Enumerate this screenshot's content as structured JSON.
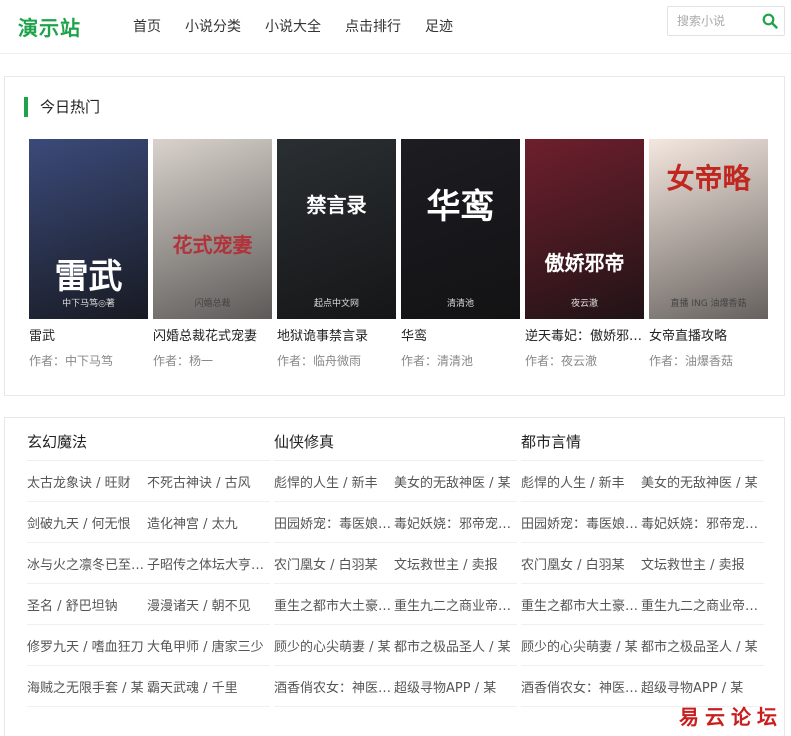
{
  "header": {
    "logo": "演示站",
    "nav": [
      "首页",
      "小说分类",
      "小说大全",
      "点击排行",
      "足迹"
    ],
    "search_placeholder": "搜索小说"
  },
  "hot": {
    "title": "今日热门",
    "books": [
      {
        "title": "雷武",
        "author": "作者：中下马笃",
        "cover_text": "雷武",
        "cover_sub": "中下马笃◎著",
        "bg": "#3b4a7a"
      },
      {
        "title": "闪婚总裁花式宠妻",
        "author": "作者：杨一",
        "cover_text": "花式宠妻",
        "cover_sub": "闪婚总裁",
        "bg": "#d9d2cc"
      },
      {
        "title": "地狱诡事禁言录",
        "author": "作者：临舟微雨",
        "cover_text": "禁言录",
        "cover_sub": "起点中文网",
        "bg": "#2a2f33"
      },
      {
        "title": "华鸾",
        "author": "作者：清清池",
        "cover_text": "华鸾",
        "cover_sub": "清清池",
        "bg": "#1c1c22"
      },
      {
        "title": "逆天毒妃：傲娇邪帝强势宠",
        "author": "作者：夜云澈",
        "cover_text": "傲娇邪帝",
        "cover_sub": "夜云澈",
        "bg": "#6e1f2d"
      },
      {
        "title": "女帝直播攻略",
        "author": "作者：油爆香菇",
        "cover_text": "女帝略",
        "cover_sub": "直播 ING 油爆香菇",
        "bg": "#f4e7df"
      }
    ]
  },
  "categories": [
    {
      "name": "玄幻魔法",
      "rows": [
        [
          "太古龙象诀 / 旺财",
          "不死古神诀 / 古风"
        ],
        [
          "剑破九天 / 何无恨",
          "造化神宫 / 太九"
        ],
        [
          "冰与火之凛冬已至 / 某",
          "子昭传之体坛大亨 / 某"
        ],
        [
          "圣名 / 舒巴坦钠",
          "漫漫诸天 / 朝不见"
        ],
        [
          "修罗九天 / 嗜血狂刀",
          "大龟甲师 / 唐家三少"
        ],
        [
          "海贼之无限手套 / 某",
          "霸天武魂 / 千里"
        ]
      ]
    },
    {
      "name": "仙侠修真",
      "rows": [
        [
          "彪悍的人生 / 新丰",
          "美女的无敌神医 / 某"
        ],
        [
          "田园娇宠：毒医娘子 / 某",
          "毒妃妖娆：邪帝宠 / 某"
        ],
        [
          "农门凰女 / 白羽某",
          "文坛救世主 / 卖报"
        ],
        [
          "重生之都市大土豪 / 某",
          "重生九二之商业帝国 / 某"
        ],
        [
          "顾少的心尖萌妻 / 某",
          "都市之极品圣人 / 某"
        ],
        [
          "酒香俏农女：神医 / 某",
          "超级寻物APP / 某"
        ]
      ]
    },
    {
      "name": "都市言情",
      "rows": [
        [
          "彪悍的人生 / 新丰",
          "美女的无敌神医 / 某"
        ],
        [
          "田园娇宠：毒医娘子 / 某",
          "毒妃妖娆：邪帝宠 / 某"
        ],
        [
          "农门凰女 / 白羽某",
          "文坛救世主 / 卖报"
        ],
        [
          "重生之都市大土豪 / 某",
          "重生九二之商业帝国 / 某"
        ],
        [
          "顾少的心尖萌妻 / 某",
          "都市之极品圣人 / 某"
        ],
        [
          "酒香俏农女：神医 / 某",
          "超级寻物APP / 某"
        ]
      ]
    }
  ],
  "watermark": "易云论坛",
  "colors": {
    "accent": "#1ea34a",
    "watermark": "#c81e1e"
  }
}
